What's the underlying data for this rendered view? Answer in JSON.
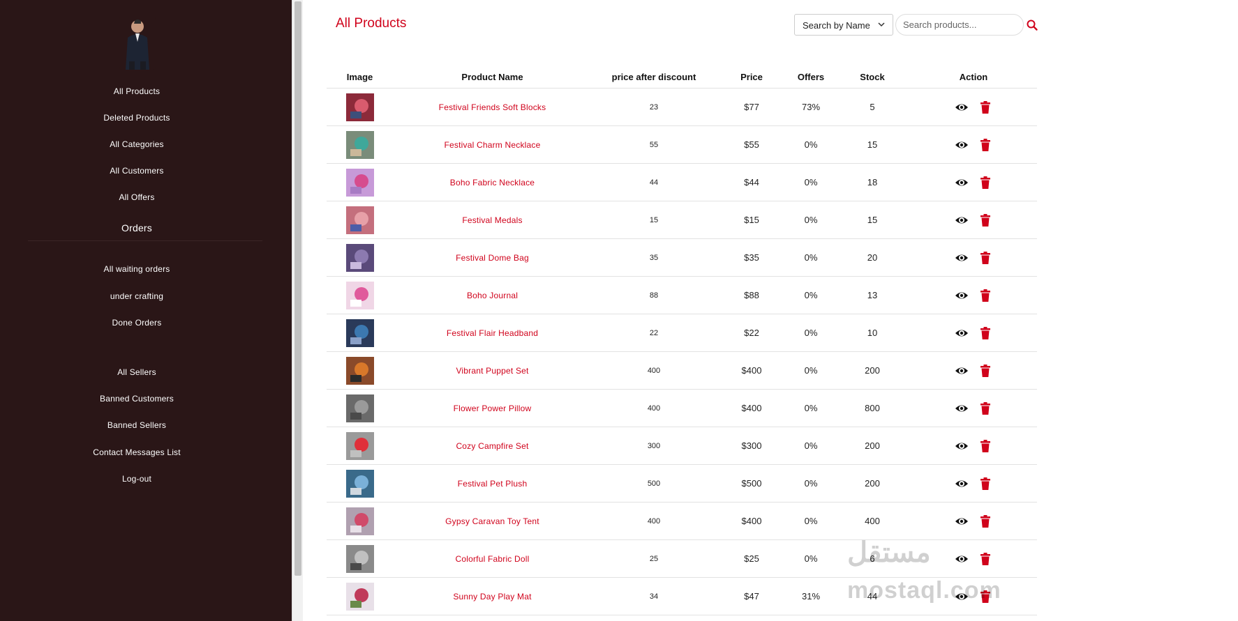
{
  "sidebar": {
    "items": [
      {
        "label": "All Products"
      },
      {
        "label": "Deleted Products"
      },
      {
        "label": "All Categories"
      },
      {
        "label": "All Customers"
      },
      {
        "label": "All Offers"
      },
      {
        "label": "Orders"
      },
      {
        "label": "All waiting orders"
      },
      {
        "label": "under crafting"
      },
      {
        "label": "Done Orders"
      },
      {
        "label": "All Sellers"
      },
      {
        "label": "Banned Customers"
      },
      {
        "label": "Banned Sellers"
      },
      {
        "label": "Contact Messages List"
      },
      {
        "label": "Log-out"
      }
    ]
  },
  "header": {
    "title": "All Products",
    "search_by": "Search by Name",
    "search_placeholder": "Search products..."
  },
  "table": {
    "columns": [
      "Image",
      "Product Name",
      "price after discount",
      "Price",
      "Offers",
      "Stock",
      "Action"
    ],
    "rows": [
      {
        "name": "Festival Friends Soft Blocks",
        "discount_price": "23",
        "price": "$77",
        "offers": "73%",
        "stock": "5"
      },
      {
        "name": "Festival Charm Necklace",
        "discount_price": "55",
        "price": "$55",
        "offers": "0%",
        "stock": "15"
      },
      {
        "name": "Boho Fabric Necklace",
        "discount_price": "44",
        "price": "$44",
        "offers": "0%",
        "stock": "18"
      },
      {
        "name": "Festival Medals",
        "discount_price": "15",
        "price": "$15",
        "offers": "0%",
        "stock": "15"
      },
      {
        "name": "Festival Dome Bag",
        "discount_price": "35",
        "price": "$35",
        "offers": "0%",
        "stock": "20"
      },
      {
        "name": "Boho Journal",
        "discount_price": "88",
        "price": "$88",
        "offers": "0%",
        "stock": "13"
      },
      {
        "name": "Festival Flair Headband",
        "discount_price": "22",
        "price": "$22",
        "offers": "0%",
        "stock": "10"
      },
      {
        "name": "Vibrant Puppet Set",
        "discount_price": "400",
        "price": "$400",
        "offers": "0%",
        "stock": "200"
      },
      {
        "name": "Flower Power Pillow",
        "discount_price": "400",
        "price": "$400",
        "offers": "0%",
        "stock": "800"
      },
      {
        "name": "Cozy Campfire Set",
        "discount_price": "300",
        "price": "$300",
        "offers": "0%",
        "stock": "200"
      },
      {
        "name": "Festival Pet Plush",
        "discount_price": "500",
        "price": "$500",
        "offers": "0%",
        "stock": "200"
      },
      {
        "name": "Gypsy Caravan Toy Tent",
        "discount_price": "400",
        "price": "$400",
        "offers": "0%",
        "stock": "400"
      },
      {
        "name": "Colorful Fabric Doll",
        "discount_price": "25",
        "price": "$25",
        "offers": "0%",
        "stock": "6"
      },
      {
        "name": "Sunny Day Play Mat",
        "discount_price": "34",
        "price": "$47",
        "offers": "31%",
        "stock": "44"
      }
    ]
  },
  "watermark": {
    "arabic": "مستقل",
    "latin": "mostaql.com"
  },
  "colors": {
    "accent": "#d0021b",
    "sidebar": "#2a1617"
  },
  "icons": {
    "view": "eye-icon",
    "delete": "trash-icon",
    "search": "search-icon",
    "dropdown": "chevron-down-icon"
  }
}
